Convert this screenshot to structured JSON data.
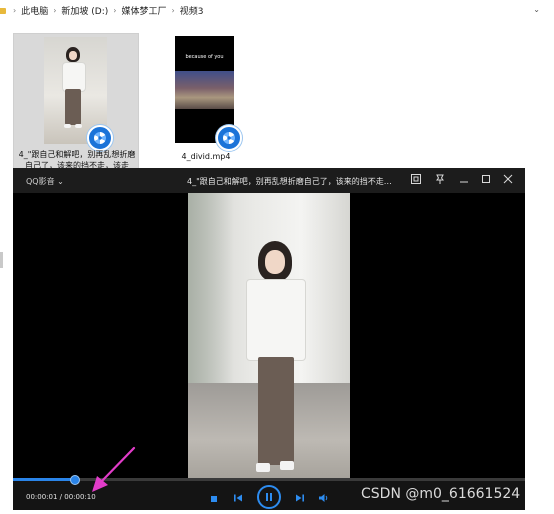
{
  "explorer": {
    "breadcrumb": [
      "此电脑",
      "新加坡 (D:)",
      "媒体梦工厂",
      "视频3"
    ]
  },
  "files": [
    {
      "name": "4_\"跟自己和解吧，别再乱想折磨自己了，该来的挡不走，该走的..."
    },
    {
      "name": "4_divid.mp4",
      "thumbnail_caption": "because of you"
    }
  ],
  "player": {
    "brand": "QQ影音",
    "title": "4_\"跟自己和解吧，别再乱想折磨自己了，该来的挡不走，该走...",
    "time_display": "00:00:01 / 00:00:10",
    "progress_fraction": 0.12,
    "accent_color": "#2a84e8",
    "icons": [
      "chevron-down-icon",
      "screenshot-icon",
      "pin-icon",
      "minimize-icon",
      "maximize-icon",
      "close-icon",
      "stop-icon",
      "previous-icon",
      "pause-icon",
      "next-icon",
      "volume-icon"
    ]
  },
  "watermark": "CSDN @m0_61661524",
  "annotation_color": "#e23cc9"
}
